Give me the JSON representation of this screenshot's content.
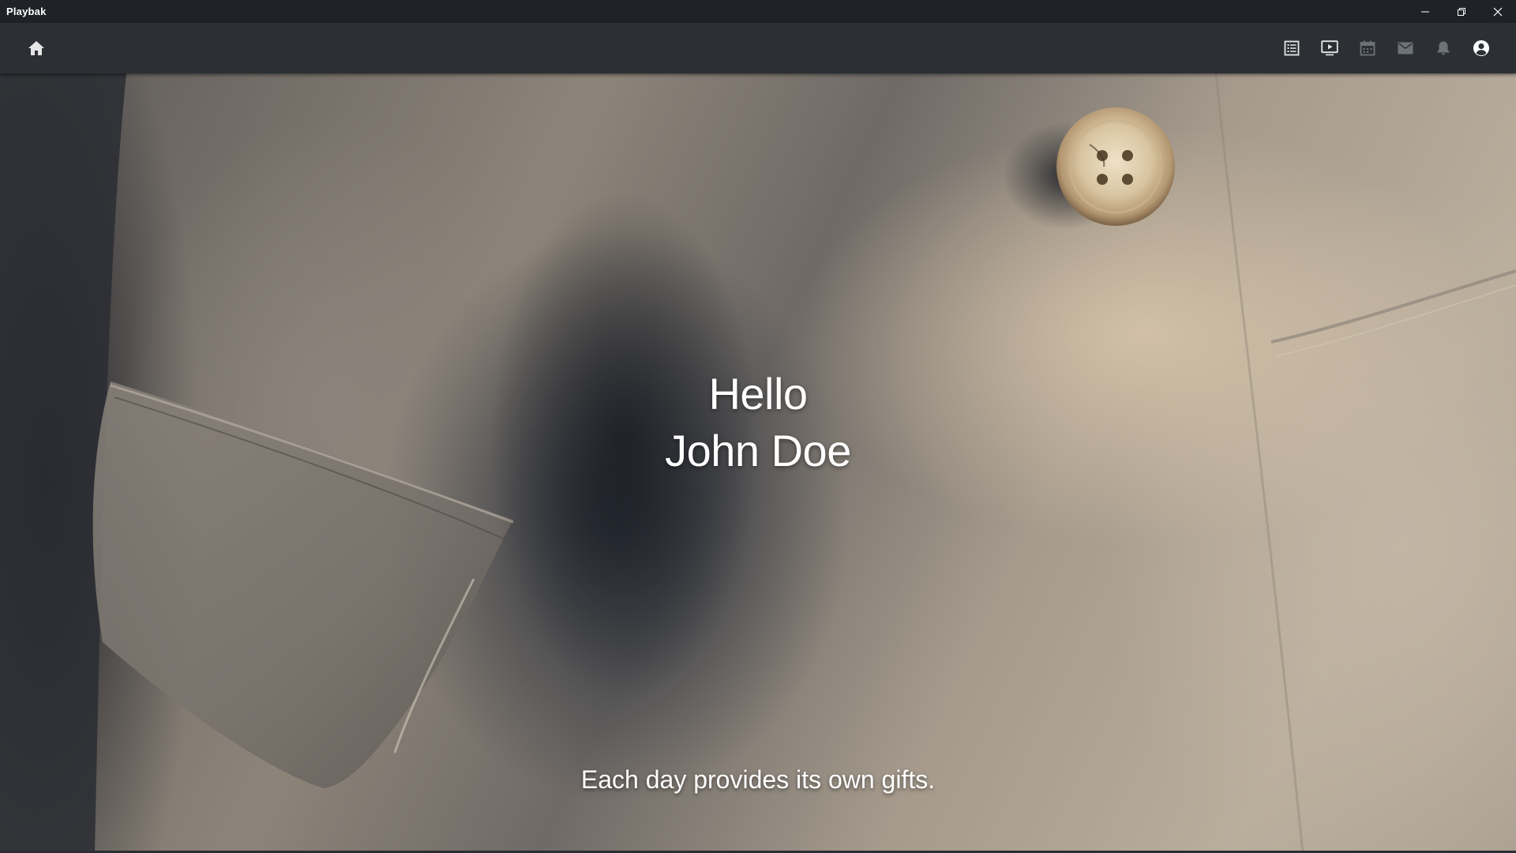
{
  "window": {
    "title": "Playbak",
    "controls": [
      {
        "name": "minimize",
        "icon": "minimize-icon"
      },
      {
        "name": "restore",
        "icon": "restore-icon"
      },
      {
        "name": "close",
        "icon": "close-icon"
      }
    ]
  },
  "toolbar": {
    "home_icon": "home-icon",
    "actions": [
      {
        "name": "list",
        "icon": "list-icon",
        "color": "#e6e6e6"
      },
      {
        "name": "video",
        "icon": "video-player-icon",
        "color": "#e6e6e6"
      },
      {
        "name": "calendar",
        "icon": "calendar-icon",
        "color": "#6e7378"
      },
      {
        "name": "mail",
        "icon": "mail-icon",
        "color": "#6e7378"
      },
      {
        "name": "notifications",
        "icon": "bell-icon",
        "color": "#6e7378"
      },
      {
        "name": "account",
        "icon": "account-icon",
        "color": "#ffffff"
      }
    ]
  },
  "hero": {
    "greeting_line1": "Hello",
    "greeting_line2": "John Doe",
    "quote": "Each day provides its own gifts."
  },
  "colors": {
    "titlebar": "#1f2328",
    "toolbar": "#2c3034",
    "icon_active": "#e6e6e6",
    "icon_inactive": "#6e7378"
  }
}
